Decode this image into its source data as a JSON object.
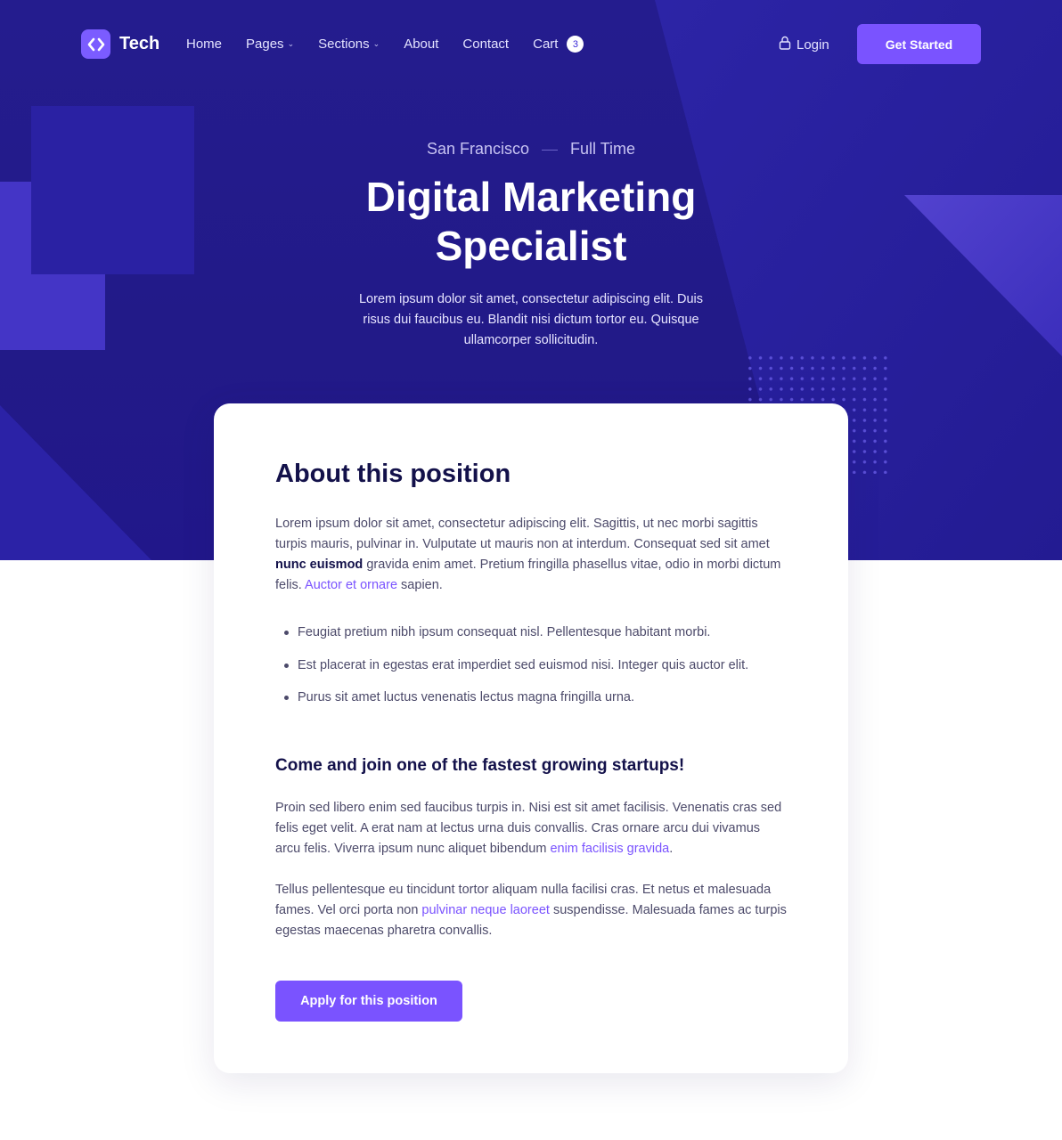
{
  "nav": {
    "logo_text": "Tech",
    "items": [
      {
        "label": "Home",
        "dropdown": false
      },
      {
        "label": "Pages",
        "dropdown": true
      },
      {
        "label": "Sections",
        "dropdown": true
      },
      {
        "label": "About",
        "dropdown": false
      },
      {
        "label": "Contact",
        "dropdown": false
      },
      {
        "label": "Cart",
        "dropdown": false
      }
    ],
    "cart_count": "3",
    "login_label": "Login",
    "cta_label": "Get Started"
  },
  "hero": {
    "location": "San Francisco",
    "job_type": "Full Time",
    "title": "Digital Marketing Specialist",
    "subtitle": "Lorem ipsum dolor sit amet, consectetur adipiscing elit. Duis risus dui faucibus eu. Blandit nisi dictum tortor eu. Quisque ullamcorper sollicitudin."
  },
  "card": {
    "heading": "About this position",
    "intro": {
      "text1": "Lorem ipsum dolor sit amet, consectetur adipiscing elit. Sagittis, ut nec morbi sagittis turpis mauris, pulvinar in. Vulputate ut mauris non at interdum. Consequat sed sit amet ",
      "bold": "nunc euismod",
      "text2": " gravida enim amet. Pretium fringilla phasellus vitae, odio in morbi dictum felis. ",
      "link": "Auctor et ornare",
      "text3": " sapien."
    },
    "bullets": [
      "Feugiat pretium nibh ipsum consequat nisl. Pellentesque habitant morbi.",
      "Est placerat in egestas erat imperdiet sed euismod nisi. Integer quis auctor elit.",
      "Purus sit amet luctus venenatis lectus magna fringilla urna."
    ],
    "subheading": "Come and join one of the fastest growing startups!",
    "para2": {
      "text1": "Proin sed libero enim sed faucibus turpis in. Nisi est sit amet facilisis. Venenatis cras sed felis eget velit. A erat nam at lectus urna duis convallis. Cras ornare arcu dui vivamus arcu felis. Viverra ipsum nunc aliquet bibendum ",
      "link": "enim facilisis gravida",
      "text2": "."
    },
    "para3": {
      "text1": "Tellus pellentesque eu tincidunt tortor aliquam nulla facilisi cras. Et netus et malesuada fames. Vel orci porta non ",
      "link": "pulvinar neque laoreet",
      "text2": " suspendisse. Malesuada fames ac turpis egestas maecenas pharetra convallis."
    },
    "apply_label": "Apply for this position"
  },
  "colors": {
    "hero_bg": "#241c8e",
    "accent": "#7a53ff",
    "heading": "#13114a",
    "body_text": "#4c4a6a"
  },
  "icons": {
    "logo": "code-brackets-icon",
    "login": "lock-icon",
    "dropdown": "chevron-down-icon"
  }
}
